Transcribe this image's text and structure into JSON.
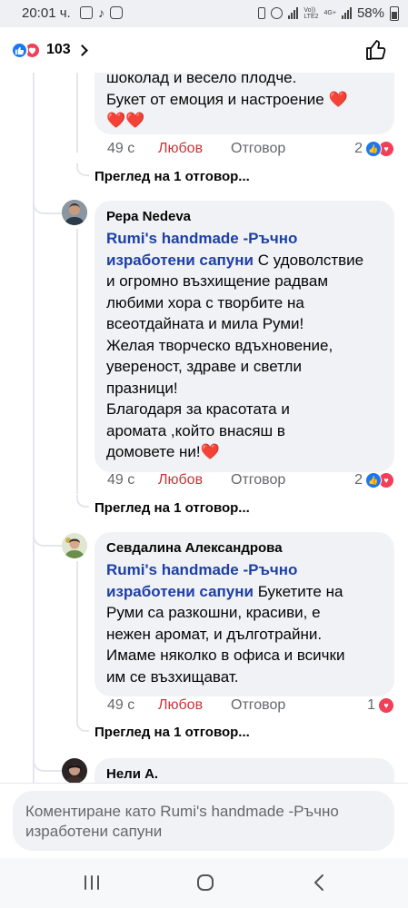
{
  "status_bar": {
    "time": "20:01 ч.",
    "battery": "58%",
    "network": "Vo))\nLTE2",
    "network2": "4G+"
  },
  "header": {
    "reaction_count": "103"
  },
  "comments": [
    {
      "body_tail_line1": "шоколад и весело плодче.",
      "body_tail_line2": "Букет от емоция и настроение",
      "time": "49 с",
      "love": "Любов",
      "reply": "Отговор",
      "reactions_count": "2",
      "view_replies": "Преглед на 1 отговор..."
    },
    {
      "author": "Рера Nedeva",
      "mention_l1": "Rumi's handmade -Ръчно",
      "mention_l2": "изработени сапуни",
      "lines": [
        " С удоволствие",
        "и огромно възхищение радвам",
        "любими хора с творбите на",
        "всеотдайната и мила Руми!",
        "Желая творческо вдъхновение,",
        "увереност, здраве и светли",
        "празници!",
        "Благодаря за красотата и",
        "аромата ,който внасяш в",
        "домовете ни!"
      ],
      "time": "49 с",
      "love": "Любов",
      "reply": "Отговор",
      "reactions_count": "2",
      "view_replies": "Преглед на 1 отговор..."
    },
    {
      "author": "Севдалина Александрова",
      "mention_l1": "Rumi's handmade -Ръчно",
      "mention_l2": "изработени сапуни",
      "lines": [
        " Букетите на",
        "Руми са разкошни, красиви, е",
        "нежен аромат, и дълготрайни.",
        "Имаме няколко в офиса и всички",
        "им се възхищават."
      ],
      "time": "49 с",
      "love": "Любов",
      "reply": "Отговор",
      "reactions_count": "1",
      "view_replies": "Преглед на 1 отговор..."
    },
    {
      "author": "Нели А."
    }
  ],
  "composer": {
    "line1": "Коментиране като Rumi's handmade -Ръчно",
    "line2": "изработени сапуни"
  },
  "colors": {
    "like_blue": "#1877f2",
    "love_red": "#f33e58",
    "mention_blue": "#1d3fa8",
    "love_action": "#c9343b",
    "bubble_bg": "#f0f2f5"
  }
}
